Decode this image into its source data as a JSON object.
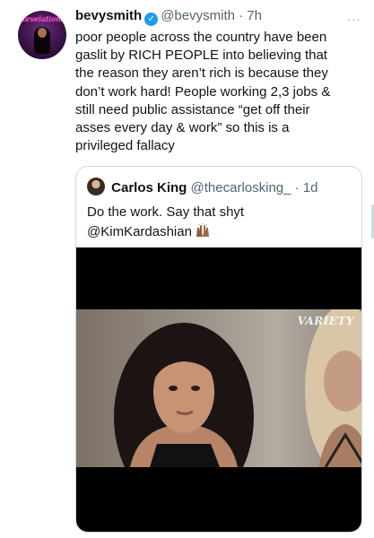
{
  "tweet": {
    "display_name": "bevysmith",
    "handle": "@bevysmith",
    "separator": "·",
    "time": "7h",
    "verified_icon": "verified-badge-icon",
    "avatar_logo": "Revelations",
    "text": "poor people across the country have been\ngaslit by RICH PEOPLE into believing that\nthe reason they aren’t rich is because they\ndon’t work hard! People working 2,3 jobs &\nstill need public assistance “get off their\nasses every day & work” so this is a\nprivileged fallacy"
  },
  "quoted": {
    "display_name": "Carlos King",
    "handle": "@thecarlosking_",
    "separator": "·",
    "time": "1d",
    "text": "Do the work. Say that shyt",
    "mention": "@KimKardashian",
    "emoji_icon": "raising-hands-emoji-icon",
    "media_watermark": "VARIETY"
  },
  "more_icon": "···",
  "colors": {
    "text": "#0f1419",
    "secondary": "#536471",
    "border": "#cfd9de",
    "verified": "#1d9bf0",
    "avatar_bg": "#3a1247"
  }
}
